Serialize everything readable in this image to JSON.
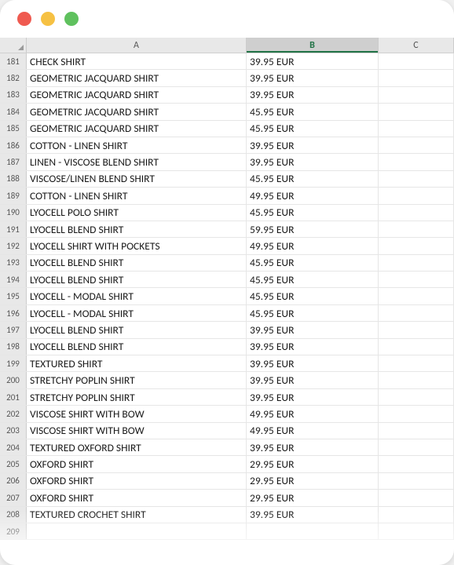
{
  "window": {
    "buttons": [
      "close",
      "minimize",
      "zoom"
    ]
  },
  "columns": [
    {
      "id": "A",
      "label": "A",
      "selected": false
    },
    {
      "id": "B",
      "label": "B",
      "selected": true
    },
    {
      "id": "C",
      "label": "C",
      "selected": false
    }
  ],
  "chart_data": {
    "type": "table",
    "columns": [
      "row",
      "A",
      "B"
    ],
    "rows": [
      {
        "row": 181,
        "A": "CHECK SHIRT",
        "B": "39.95 EUR"
      },
      {
        "row": 182,
        "A": "GEOMETRIC JACQUARD SHIRT",
        "B": "39.95 EUR"
      },
      {
        "row": 183,
        "A": "GEOMETRIC JACQUARD SHIRT",
        "B": "39.95 EUR"
      },
      {
        "row": 184,
        "A": "GEOMETRIC JACQUARD SHIRT",
        "B": "45.95 EUR"
      },
      {
        "row": 185,
        "A": "GEOMETRIC JACQUARD SHIRT",
        "B": "45.95 EUR"
      },
      {
        "row": 186,
        "A": "COTTON - LINEN SHIRT",
        "B": "39.95 EUR"
      },
      {
        "row": 187,
        "A": "LINEN - VISCOSE BLEND SHIRT",
        "B": "39.95 EUR"
      },
      {
        "row": 188,
        "A": "VISCOSE/LINEN BLEND SHIRT",
        "B": "45.95 EUR"
      },
      {
        "row": 189,
        "A": "COTTON - LINEN SHIRT",
        "B": "49.95 EUR"
      },
      {
        "row": 190,
        "A": "LYOCELL POLO SHIRT",
        "B": "45.95 EUR"
      },
      {
        "row": 191,
        "A": "LYOCELL BLEND SHIRT",
        "B": "59.95 EUR"
      },
      {
        "row": 192,
        "A": "LYOCELL SHIRT WITH POCKETS",
        "B": "49.95 EUR"
      },
      {
        "row": 193,
        "A": "LYOCELL BLEND SHIRT",
        "B": "45.95 EUR"
      },
      {
        "row": 194,
        "A": "LYOCELL BLEND SHIRT",
        "B": "45.95 EUR"
      },
      {
        "row": 195,
        "A": "LYOCELL - MODAL SHIRT",
        "B": "45.95 EUR"
      },
      {
        "row": 196,
        "A": "LYOCELL - MODAL SHIRT",
        "B": "45.95 EUR"
      },
      {
        "row": 197,
        "A": "LYOCELL BLEND SHIRT",
        "B": "39.95 EUR"
      },
      {
        "row": 198,
        "A": "LYOCELL BLEND SHIRT",
        "B": "39.95 EUR"
      },
      {
        "row": 199,
        "A": "TEXTURED SHIRT",
        "B": "39.95 EUR"
      },
      {
        "row": 200,
        "A": "STRETCHY POPLIN SHIRT",
        "B": "39.95 EUR"
      },
      {
        "row": 201,
        "A": "STRETCHY POPLIN SHIRT",
        "B": "39.95 EUR"
      },
      {
        "row": 202,
        "A": "VISCOSE SHIRT WITH BOW",
        "B": "49.95 EUR"
      },
      {
        "row": 203,
        "A": "VISCOSE SHIRT WITH BOW",
        "B": "49.95 EUR"
      },
      {
        "row": 204,
        "A": "TEXTURED OXFORD SHIRT",
        "B": "39.95 EUR"
      },
      {
        "row": 205,
        "A": "OXFORD SHIRT",
        "B": "29.95 EUR"
      },
      {
        "row": 206,
        "A": "OXFORD SHIRT",
        "B": "29.95 EUR"
      },
      {
        "row": 207,
        "A": "OXFORD SHIRT",
        "B": "29.95 EUR"
      },
      {
        "row": 208,
        "A": "TEXTURED CROCHET SHIRT",
        "B": "39.95 EUR"
      },
      {
        "row": 209,
        "A": "",
        "B": ""
      }
    ]
  }
}
